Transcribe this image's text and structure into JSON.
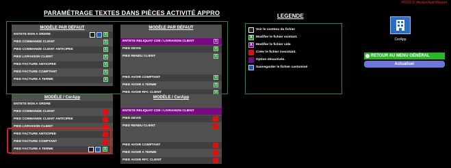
{
  "header": {
    "title": "PARAMÉTRAGE TEXTES DANS PIÈCES ACTIVITÉ APPRO",
    "legend_title": "LEGENDE",
    "prod_tag": "PROD D:\\Analys\\Appli\\Report"
  },
  "default_left": {
    "title": "MODÈLE PAR DÉFAUT",
    "rows": [
      {
        "label": "ENTETE BON A ORDRE"
      },
      {
        "label": "PIED COMMANDE CLIENT"
      },
      {
        "label": "PIED COMMANDE CLIENT ANTICIPEE"
      },
      {
        "label": "PIED LIVRAISON CLIENT"
      },
      {
        "label": "PIED FACTURE ANTICIPEE"
      },
      {
        "label": "PIED FACTURE COMPTANT"
      },
      {
        "label": "PIED FACTURE A TERME"
      }
    ]
  },
  "default_right": {
    "title": "MODÈLE PAR DÉFAUT",
    "rows": [
      {
        "label": "ENTETE RELIQUAT CDE / LIVRAISON CLIENT"
      },
      {
        "label": "PIED DEVIS"
      },
      {
        "label": "PIED RENDU CLIENT"
      },
      {
        "label": "PIED AVOIR COMPTANT"
      },
      {
        "label": "PIED AVOIR A TERME"
      },
      {
        "label": "PIED AVOIR RFC CLIENT"
      }
    ]
  },
  "cerapp_left": {
    "title": "MODÈLE / CerApp",
    "rows": [
      {
        "label": "ENTETE BON A ORDRE"
      },
      {
        "label": "PIED COMMANDE CLIENT"
      },
      {
        "label": "PIED COMMANDE CLIENT ANTICIPEE"
      },
      {
        "label": "PIED LIVRAISON CLIENT"
      },
      {
        "label": "PIED FACTURE ANTICIPEE"
      },
      {
        "label": "PIED FACTURE COMPTANT"
      },
      {
        "label": "PIED FACTURE A TERME"
      }
    ]
  },
  "cerapp_right": {
    "title": "MODÈLE / CerApp",
    "rows": [
      {
        "label": "ENTETE RELIQUAT CDE / LIVRAISON CLIENT"
      },
      {
        "label": "PIED DEVIS"
      },
      {
        "label": "PIED RENDU CLIENT"
      },
      {
        "label": "PIED AVOIR COMPTANT"
      },
      {
        "label": "PIED AVOIR A TERME"
      },
      {
        "label": "PIED AVOIR RFC CLIENT"
      }
    ]
  },
  "legend": [
    {
      "icon": "view-file-icon",
      "color": "#ffffff",
      "text": "Voir le contenu du fichier"
    },
    {
      "icon": "edit-existing-icon",
      "color": "#1f8f3a",
      "text": "Modifier le fichier existant."
    },
    {
      "icon": "edit-empty-icon",
      "color": "#7a0a82",
      "text": "Modifier le fichier vide"
    },
    {
      "icon": "create-file-icon",
      "color": "#e01010",
      "text": "Créer le fichier inexistant."
    },
    {
      "icon": "disabled-option-icon",
      "color": "#7a0a82",
      "text": "Option désactivée."
    },
    {
      "icon": "save-custom-icon",
      "color": "#1e5aa8",
      "text": "Sauvegarder le fichier customisé"
    }
  ],
  "app": {
    "icon": "building-icon",
    "name": "CerApp"
  },
  "actions": {
    "back_label": "RETOUR AU MENU GÉNÉRAL",
    "refresh_label": "Actualiser"
  },
  "colors": {
    "panel": "#505050",
    "row_dark": "#404040",
    "purple": "#7a0a82",
    "green": "#27b827",
    "red": "#e01010",
    "blue_btn": "#6b77d8"
  }
}
